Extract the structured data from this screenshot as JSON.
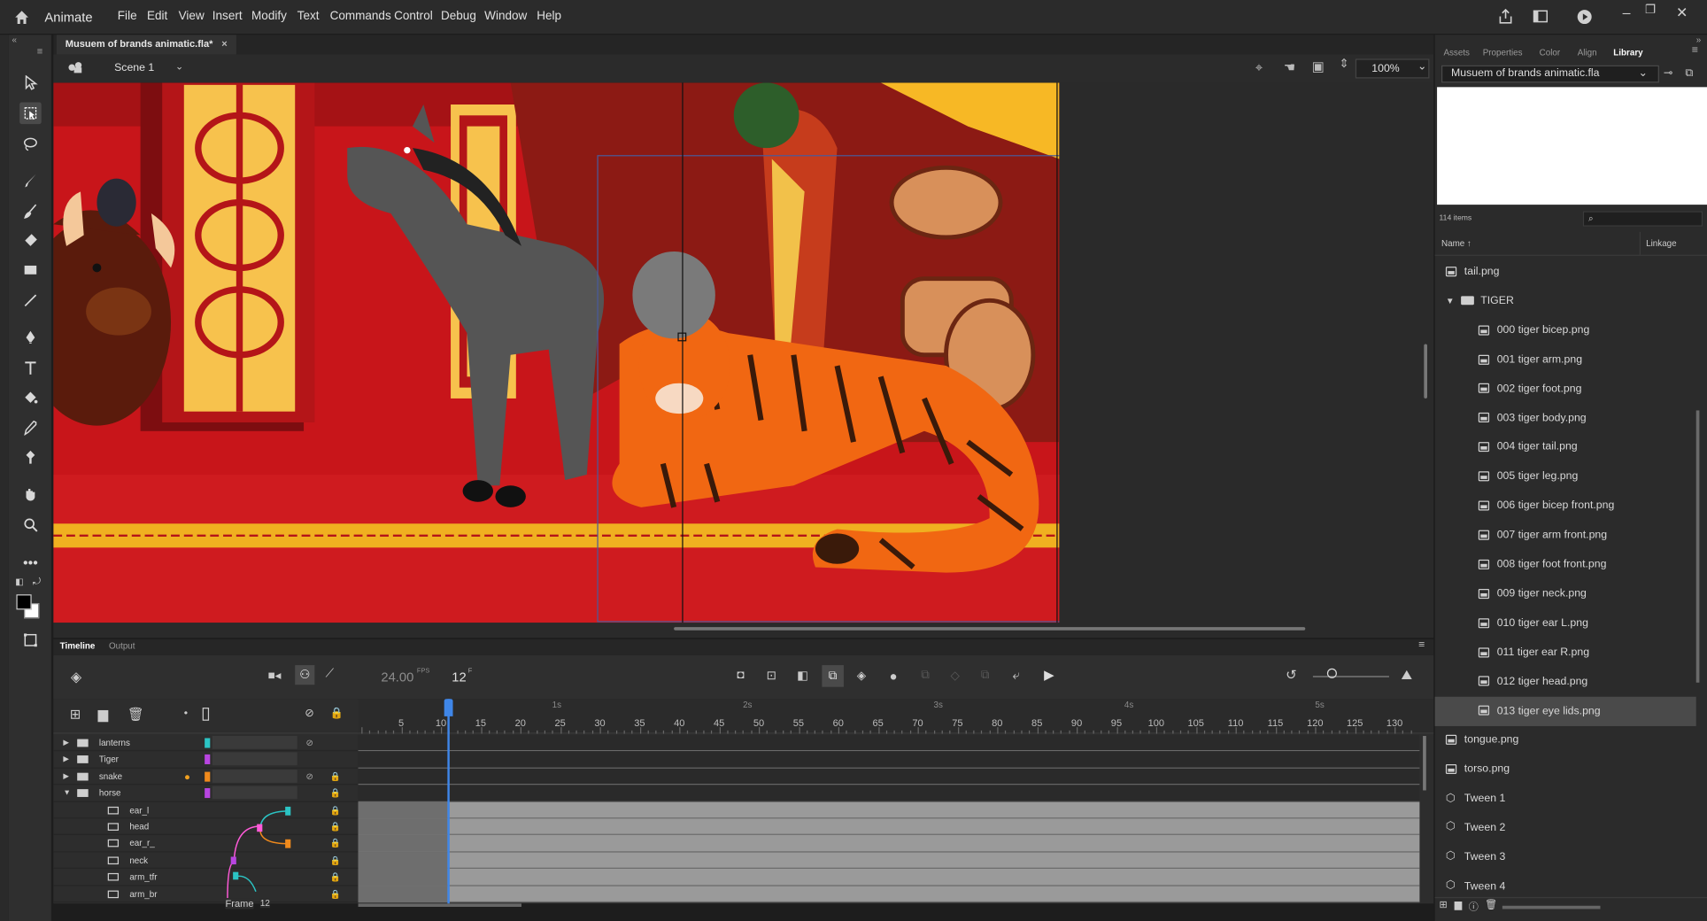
{
  "app": {
    "name": "Animate",
    "menu": [
      "File",
      "Edit",
      "View",
      "Insert",
      "Modify",
      "Text",
      "Commands",
      "Control",
      "Debug",
      "Window",
      "Help"
    ]
  },
  "document": {
    "tab_title": "Musuem of brands animatic.fla*",
    "scene": "Scene 1",
    "zoom": "100%"
  },
  "timeline": {
    "tabs": [
      "Timeline",
      "Output"
    ],
    "fps": "24.00",
    "fps_unit": "FPS",
    "frame": "12",
    "frame_unit": "F",
    "frame_label": "Frame",
    "frame_label_value": "12",
    "seconds": [
      "1s",
      "2s",
      "3s",
      "4s",
      "5s"
    ],
    "frame_numbers": [
      "5",
      "10",
      "15",
      "20",
      "25",
      "30",
      "35",
      "40",
      "45",
      "50",
      "55",
      "60",
      "65",
      "70",
      "75",
      "80",
      "85",
      "90",
      "95",
      "100",
      "105",
      "110",
      "115",
      "120",
      "125",
      "130"
    ],
    "layers": [
      {
        "name": "lanterns",
        "type": "folder",
        "color": "#2bc4c4",
        "state": "collapsed",
        "hidden": true
      },
      {
        "name": "Tiger",
        "type": "folder",
        "color": "#b845e0",
        "state": "collapsed"
      },
      {
        "name": "snake",
        "type": "folder",
        "color": "#f08a1c",
        "state": "collapsed",
        "hidden": true,
        "locked": true,
        "dot": true
      },
      {
        "name": "horse",
        "type": "folder",
        "color": "#b845e0",
        "state": "expanded",
        "locked": true
      },
      {
        "name": "ear_l",
        "type": "layer",
        "locked": true
      },
      {
        "name": "head",
        "type": "layer",
        "locked": true
      },
      {
        "name": "ear_r_",
        "type": "layer",
        "locked": true
      },
      {
        "name": "neck",
        "type": "layer",
        "locked": true
      },
      {
        "name": "arm_tfr",
        "type": "layer",
        "locked": true
      },
      {
        "name": "arm_br",
        "type": "layer",
        "locked": true
      }
    ]
  },
  "panel": {
    "tabs": [
      "Assets",
      "Properties",
      "Color",
      "Align",
      "Library"
    ],
    "active_tab": "Library",
    "library_file": "Musuem of brands animatic.fla",
    "item_count": "114 items",
    "col_name": "Name",
    "col_linkage": "Linkage",
    "items": [
      {
        "label": "tail.png",
        "kind": "bitmap",
        "indent": 0
      },
      {
        "label": "TIGER",
        "kind": "folder",
        "indent": 0
      },
      {
        "label": "000 tiger bicep.png",
        "kind": "bitmap",
        "indent": 1
      },
      {
        "label": "001 tiger arm.png",
        "kind": "bitmap",
        "indent": 1
      },
      {
        "label": "002 tiger foot.png",
        "kind": "bitmap",
        "indent": 1
      },
      {
        "label": "003 tiger body.png",
        "kind": "bitmap",
        "indent": 1
      },
      {
        "label": "004 tiger tail.png",
        "kind": "bitmap",
        "indent": 1
      },
      {
        "label": "005 tiger leg.png",
        "kind": "bitmap",
        "indent": 1
      },
      {
        "label": "006 tiger bicep front.png",
        "kind": "bitmap",
        "indent": 1
      },
      {
        "label": "007 tiger arm front.png",
        "kind": "bitmap",
        "indent": 1
      },
      {
        "label": "008 tiger foot front.png",
        "kind": "bitmap",
        "indent": 1
      },
      {
        "label": "009 tiger neck.png",
        "kind": "bitmap",
        "indent": 1
      },
      {
        "label": "010 tiger ear L.png",
        "kind": "bitmap",
        "indent": 1
      },
      {
        "label": "011 tiger ear R.png",
        "kind": "bitmap",
        "indent": 1
      },
      {
        "label": "012 tiger head.png",
        "kind": "bitmap",
        "indent": 1
      },
      {
        "label": "013 tiger eye lids.png",
        "kind": "bitmap",
        "indent": 1,
        "selected": true
      },
      {
        "label": "tongue.png",
        "kind": "bitmap",
        "indent": 0
      },
      {
        "label": "torso.png",
        "kind": "bitmap",
        "indent": 0
      },
      {
        "label": "Tween 1",
        "kind": "symbol",
        "indent": 0
      },
      {
        "label": "Tween 2",
        "kind": "symbol",
        "indent": 0
      },
      {
        "label": "Tween 3",
        "kind": "symbol",
        "indent": 0
      },
      {
        "label": "Tween 4",
        "kind": "symbol",
        "indent": 0
      }
    ]
  }
}
